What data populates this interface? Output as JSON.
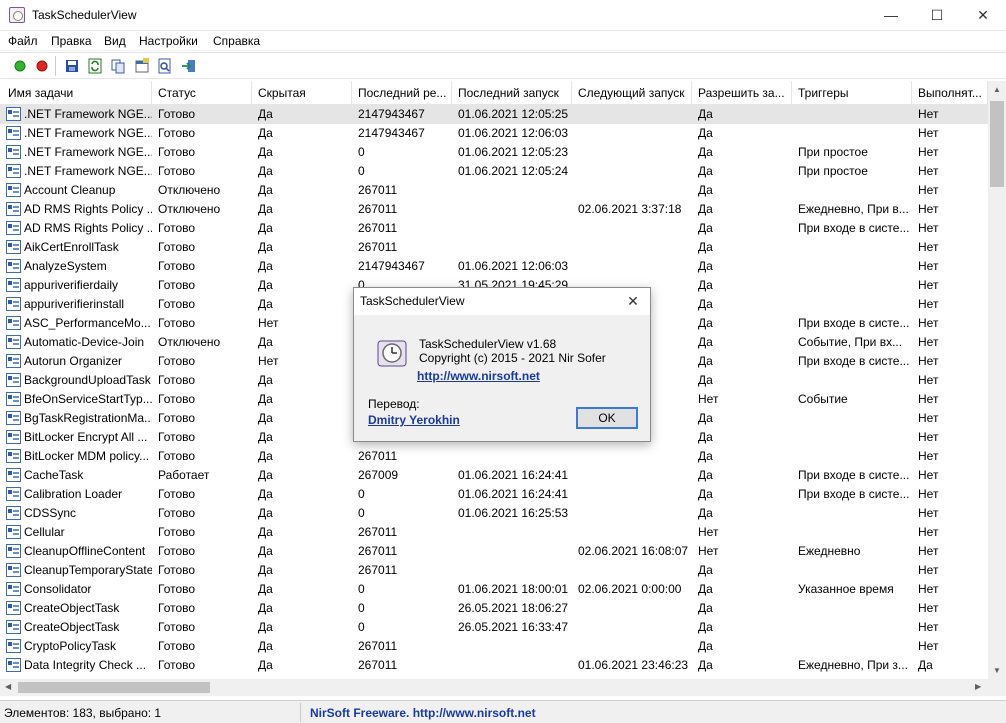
{
  "window": {
    "title": "TaskSchedulerView",
    "minimize_glyph": "—",
    "maximize_glyph": "☐",
    "close_glyph": "✕"
  },
  "menu": [
    "Файл",
    "Правка",
    "Вид",
    "Настройки",
    "Справка"
  ],
  "toolbar": {
    "icons": [
      "green-circle-icon",
      "red-circle-icon",
      "save-icon",
      "refresh-icon",
      "copy-icon",
      "properties-icon",
      "find-icon",
      "exit-icon"
    ]
  },
  "columns": [
    "Имя задачи",
    "Статус",
    "Скрытая",
    "Последний ре...",
    "Последний запуск",
    "Следующий запуск",
    "Разрешить за...",
    "Триггеры",
    "Выполнят..."
  ],
  "rows": [
    [
      ".NET Framework NGE...",
      "Готово",
      "Да",
      "2147943467",
      "01.06.2021 12:05:25",
      "",
      "Да",
      "",
      "Нет"
    ],
    [
      ".NET Framework NGE...",
      "Готово",
      "Да",
      "2147943467",
      "01.06.2021 12:06:03",
      "",
      "Да",
      "",
      "Нет"
    ],
    [
      ".NET Framework NGE...",
      "Готово",
      "Да",
      "0",
      "01.06.2021 12:05:23",
      "",
      "Да",
      "При простое",
      "Нет"
    ],
    [
      ".NET Framework NGE...",
      "Готово",
      "Да",
      "0",
      "01.06.2021 12:05:24",
      "",
      "Да",
      "При простое",
      "Нет"
    ],
    [
      "Account Cleanup",
      "Отключено",
      "Да",
      "267011",
      "",
      "",
      "Да",
      "",
      "Нет"
    ],
    [
      "AD RMS Rights Policy ...",
      "Отключено",
      "Да",
      "267011",
      "",
      "02.06.2021 3:37:18",
      "Да",
      "Ежедневно, При в...",
      "Нет"
    ],
    [
      "AD RMS Rights Policy ...",
      "Готово",
      "Да",
      "267011",
      "",
      "",
      "Да",
      "При входе в систе...",
      "Нет"
    ],
    [
      "AikCertEnrollTask",
      "Готово",
      "Да",
      "267011",
      "",
      "",
      "Да",
      "",
      "Нет"
    ],
    [
      "AnalyzeSystem",
      "Готово",
      "Да",
      "2147943467",
      "01.06.2021 12:06:03",
      "",
      "Да",
      "",
      "Нет"
    ],
    [
      "appuriverifierdaily",
      "Готово",
      "Да",
      "0",
      "31.05.2021 19:45:29",
      "",
      "Да",
      "",
      "Нет"
    ],
    [
      "appuriverifierinstall",
      "Готово",
      "Да",
      "",
      "",
      "",
      "Да",
      "",
      "Нет"
    ],
    [
      "ASC_PerformanceMo...",
      "Готово",
      "Нет",
      "",
      "",
      "",
      "Да",
      "При входе в систе...",
      "Нет"
    ],
    [
      "Automatic-Device-Join",
      "Отключено",
      "Да",
      "",
      "",
      "",
      "Да",
      "Событие, При вх...",
      "Нет"
    ],
    [
      "Autorun Organizer",
      "Готово",
      "Нет",
      "",
      "",
      "",
      "Да",
      "При входе в систе...",
      "Нет"
    ],
    [
      "BackgroundUploadTask",
      "Готово",
      "Да",
      "",
      "",
      "",
      "Да",
      "",
      "Нет"
    ],
    [
      "BfeOnServiceStartTyp...",
      "Готово",
      "Да",
      "",
      "",
      "",
      "Нет",
      "Событие",
      "Нет"
    ],
    [
      "BgTaskRegistrationMa...",
      "Готово",
      "Да",
      "",
      "",
      "",
      "Да",
      "",
      "Нет"
    ],
    [
      "BitLocker Encrypt All ...",
      "Готово",
      "Да",
      "",
      "",
      "",
      "Да",
      "",
      "Нет"
    ],
    [
      "BitLocker MDM policy...",
      "Готово",
      "Да",
      "267011",
      "",
      "",
      "Да",
      "",
      "Нет"
    ],
    [
      "CacheTask",
      "Работает",
      "Да",
      "267009",
      "01.06.2021 16:24:41",
      "",
      "Да",
      "При входе в систе...",
      "Нет"
    ],
    [
      "Calibration Loader",
      "Готово",
      "Да",
      "0",
      "01.06.2021 16:24:41",
      "",
      "Да",
      "При входе в систе...",
      "Нет"
    ],
    [
      "CDSSync",
      "Готово",
      "Да",
      "0",
      "01.06.2021 16:25:53",
      "",
      "Да",
      "",
      "Нет"
    ],
    [
      "Cellular",
      "Готово",
      "Да",
      "267011",
      "",
      "",
      "Нет",
      "",
      "Нет"
    ],
    [
      "CleanupOfflineContent",
      "Готово",
      "Да",
      "267011",
      "",
      "02.06.2021 16:08:07",
      "Нет",
      "Ежедневно",
      "Нет"
    ],
    [
      "CleanupTemporaryState",
      "Готово",
      "Да",
      "267011",
      "",
      "",
      "Да",
      "",
      "Нет"
    ],
    [
      "Consolidator",
      "Готово",
      "Да",
      "0",
      "01.06.2021 18:00:01",
      "02.06.2021 0:00:00",
      "Да",
      "Указанное время",
      "Нет"
    ],
    [
      "CreateObjectTask",
      "Готово",
      "Да",
      "0",
      "26.05.2021 18:06:27",
      "",
      "Да",
      "",
      "Нет"
    ],
    [
      "CreateObjectTask",
      "Готово",
      "Да",
      "0",
      "26.05.2021 16:33:47",
      "",
      "Да",
      "",
      "Нет"
    ],
    [
      "CryptoPolicyTask",
      "Готово",
      "Да",
      "267011",
      "",
      "",
      "Да",
      "",
      "Нет"
    ],
    [
      "Data Integrity Check ...",
      "Готово",
      "Да",
      "267011",
      "",
      "01.06.2021 23:46:23",
      "Да",
      "Ежедневно, При з...",
      "Да"
    ]
  ],
  "status": {
    "count": "Элементов: 183, выбрано: 1",
    "brand": "NirSoft Freeware.  http://www.nirsoft.net"
  },
  "about": {
    "title": "TaskSchedulerView",
    "close_glyph": "✕",
    "version": "TaskSchedulerView v1.68",
    "copyright": "Copyright (c) 2015 - 2021 Nir Sofer",
    "url": "http://www.nirsoft.net",
    "translation_label": "Перевод:",
    "translator": "Dmitry Yerokhin",
    "ok": "OK"
  }
}
